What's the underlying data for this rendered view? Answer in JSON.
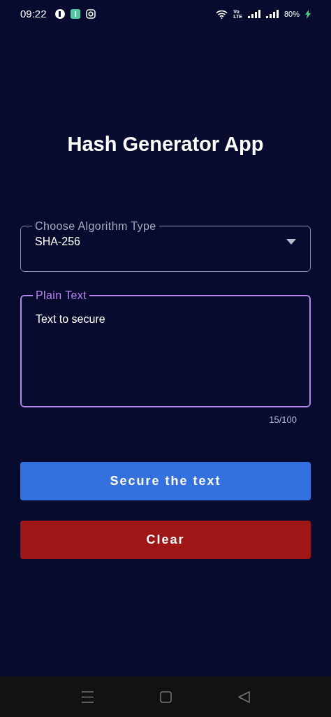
{
  "status_bar": {
    "time": "09:22",
    "network": "Vo\nLTE",
    "battery": "80%",
    "charging": true
  },
  "title": "Hash Generator App",
  "fields": [
    {
      "kind": "select",
      "label": "Choose Algorithm Type",
      "value": "SHA-256",
      "focused": false
    },
    {
      "kind": "textarea",
      "label": "Plain Text",
      "value": "Text to secure",
      "focused": true,
      "counter": "15/100"
    }
  ],
  "buttons": [
    {
      "label": "Secure the text",
      "color": "#3370e0"
    },
    {
      "label": "Clear",
      "color": "#9e1616"
    }
  ]
}
